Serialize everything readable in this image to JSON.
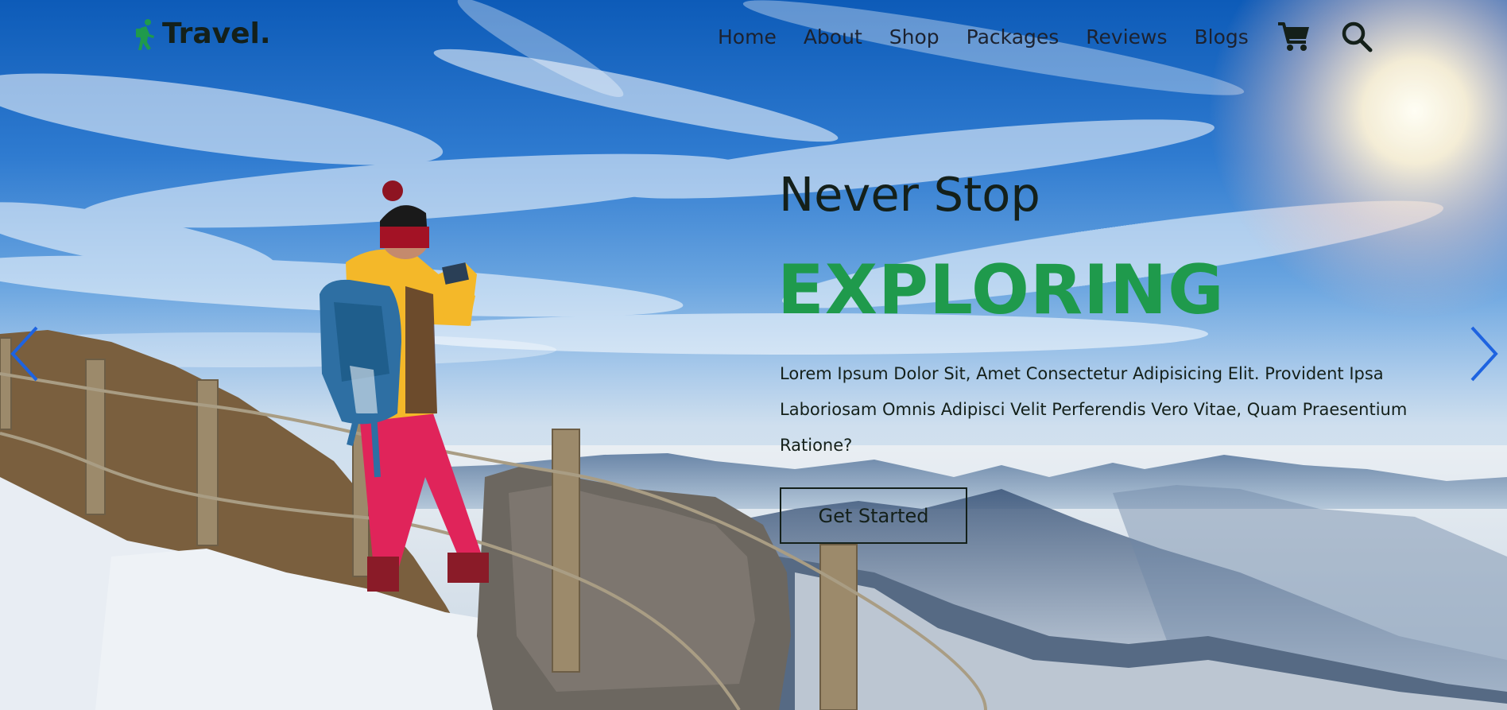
{
  "brand": {
    "name": "Travel.",
    "accent": "#1f9a4c"
  },
  "nav": {
    "items": [
      "Home",
      "About",
      "Shop",
      "Packages",
      "Reviews",
      "Blogs"
    ],
    "icons": [
      "cart-icon",
      "search-icon"
    ]
  },
  "hero": {
    "subtitle": "Never Stop",
    "title": "EXPLORING",
    "description": "Lorem Ipsum Dolor Sit, Amet Consectetur Adipisicing Elit. Provident Ipsa Laboriosam Omnis Adipisci Velit Perferendis Vero Vitae, Quam Praesentium Ratione?",
    "cta_label": "Get Started"
  },
  "carousel": {
    "prev_icon": "chevron-left-icon",
    "next_icon": "chevron-right-icon",
    "arrow_color": "#1e63e0"
  }
}
